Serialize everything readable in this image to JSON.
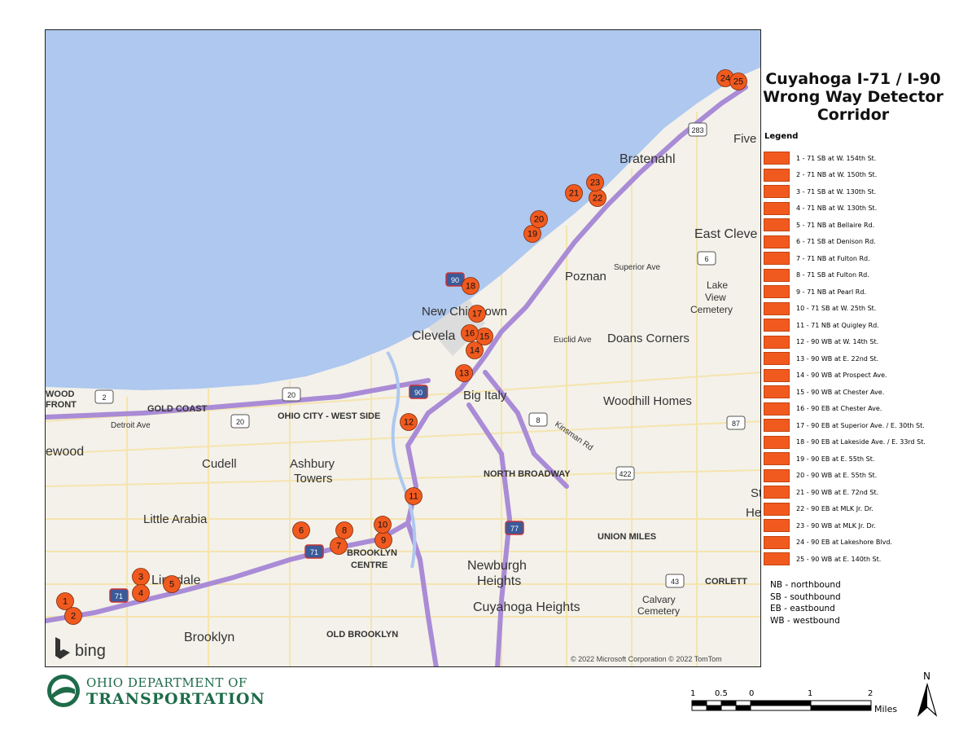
{
  "title": {
    "line1": "Cuyahoga I-71 / I-90",
    "line2": "Wrong Way Detector",
    "line3": "Corridor"
  },
  "legend": {
    "heading": "Legend",
    "swatch_color": "#f15a1f",
    "items": [
      "1 - 71 SB at W. 154th St.",
      "2 - 71 NB at W. 150th St.",
      "3 - 71 SB at W. 130th St.",
      "4 - 71 NB at W. 130th St.",
      "5 - 71 NB at Bellaire Rd.",
      "6 - 71 SB at Denison Rd.",
      "7 - 71 NB at Fulton Rd.",
      "8 - 71 SB at Fulton Rd.",
      "9 - 71 NB at Pearl Rd.",
      "10 - 71 SB at W. 25th St.",
      "11 - 71 NB at Quigley Rd.",
      "12 - 90 WB at W. 14th St.",
      "13 - 90 WB at E. 22nd St.",
      "14 - 90 WB at Prospect Ave.",
      "15 - 90 WB at Chester Ave.",
      "16 - 90 EB at Chester Ave.",
      "17 - 90 EB at Superior Ave. / E. 30th St.",
      "18 - 90 EB at Lakeside Ave. / E. 33rd St.",
      "19 - 90 EB at E. 55th St.",
      "20 - 90 WB at E. 55th St.",
      "21 - 90 WB at E. 72nd St.",
      "22 - 90 EB at MLK Jr. Dr.",
      "23 - 90 WB at MLK Jr. Dr.",
      "24 - 90 EB at Lakeshore Blvd.",
      "25 - 90 WB at E. 140th St."
    ]
  },
  "abbreviations": [
    "NB - northbound",
    "SB - southbound",
    "EB - eastbound",
    "WB - westbound"
  ],
  "map": {
    "water_color": "#aec8ef",
    "land_color": "#f3f1ea",
    "highway_color": "#a98bd6",
    "marker_color": "#f15a1f",
    "place_labels": [
      "Bratenahl",
      "Five",
      "East Cleve",
      "Poznan",
      "Lake",
      "View",
      "Cemetery",
      "New Chinatown",
      "Clevela",
      "Doans Corners",
      "Big Italy",
      "Woodhill Homes",
      "GOLD COAST",
      "OHIO CITY - WEST SIDE",
      "Detroit Ave",
      "ewood",
      "Cudell",
      "Ashbury",
      "Towers",
      "NORTH BROADWAY",
      "Little Arabia",
      "Linndale",
      "BROOKLYN",
      "CENTRE",
      "Newburgh",
      "Heights",
      "UNION MILES",
      "Cuyahoga Heights",
      "Brooklyn",
      "OLD BROOKLYN",
      "CORLETT",
      "Calvary",
      "Cemetery",
      "WOOD",
      "FRONT",
      "Superior Ave",
      "Euclid Ave",
      "Kinsman Rd",
      "St",
      "He"
    ],
    "shields": [
      "283",
      "6",
      "2",
      "20",
      "20",
      "90",
      "90",
      "8",
      "87",
      "422",
      "71",
      "71",
      "77",
      "43"
    ],
    "markers": [
      "1",
      "2",
      "3",
      "4",
      "5",
      "6",
      "7",
      "8",
      "9",
      "10",
      "11",
      "12",
      "13",
      "14",
      "15",
      "16",
      "17",
      "18",
      "19",
      "20",
      "21",
      "22",
      "23",
      "24",
      "25"
    ],
    "bing_logo": "bing",
    "attribution": "© 2022 Microsoft Corporation © 2022 TomTom"
  },
  "odot": {
    "line1": "OHIO DEPARTMENT OF",
    "line2": "TRANSPORTATION"
  },
  "scale_bar": {
    "labels": [
      "1",
      "0.5",
      "0",
      "1",
      "2"
    ],
    "unit": "Miles"
  },
  "north_arrow": {
    "label": "N"
  }
}
